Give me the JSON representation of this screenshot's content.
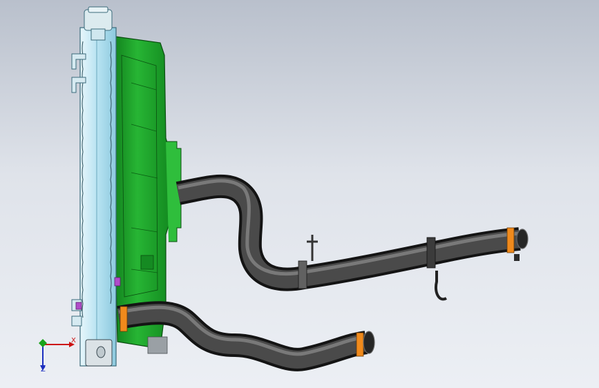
{
  "viewport": {
    "background_top": "#b9c0cc",
    "background_bottom": "#eceff4"
  },
  "model": {
    "radiator_color": "#bfe6f2",
    "fan_shroud_color": "#1ea82b",
    "hose_color": "#2b2b2b",
    "clamp_color": "#f08a1c"
  },
  "triad": {
    "x_label": "X",
    "z_label": "Z",
    "x_color": "#cc1111",
    "y_color": "#1aa31a",
    "z_color": "#1d2fbf"
  }
}
